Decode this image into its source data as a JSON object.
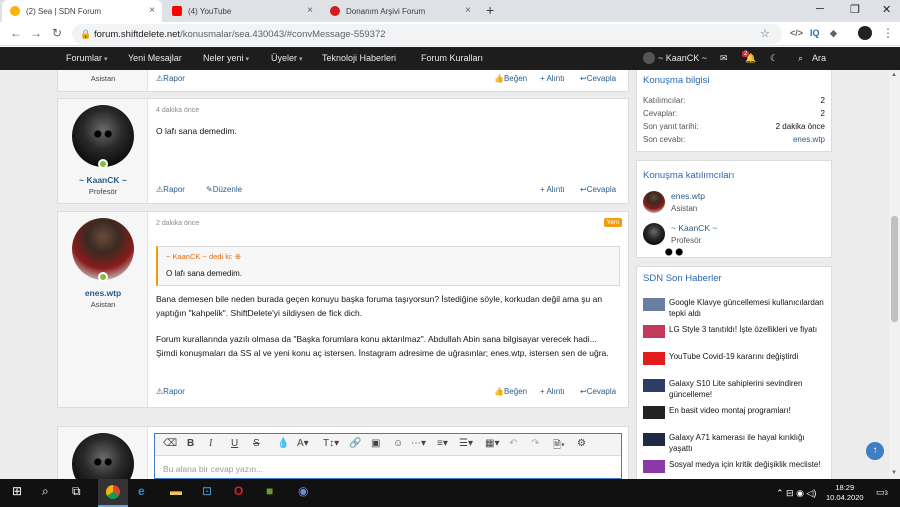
{
  "browser": {
    "tabs": [
      {
        "title": "(2) Sea | SDN Forum",
        "fav_color": "#f7b500",
        "active": true
      },
      {
        "title": "(4) YouTube",
        "fav_color": "#ff0000",
        "active": false
      },
      {
        "title": "Donanım Arşivi Forum",
        "fav_color": "#d71920",
        "active": false
      }
    ],
    "url_host": "forum.shiftdelete.net",
    "url_path": "/konusmalar/sea.430043/#convMessage-559372",
    "extensions": [
      "IQ"
    ]
  },
  "site_nav": {
    "items": [
      {
        "label": "Forumlar",
        "dropdown": true
      },
      {
        "label": "Yeni Mesajlar",
        "dropdown": false
      },
      {
        "label": "Neler yeni",
        "dropdown": true
      },
      {
        "label": "Üyeler",
        "dropdown": true
      },
      {
        "label": "Teknoloji Haberleri",
        "dropdown": false
      },
      {
        "label": "Forum Kuralları",
        "dropdown": false
      }
    ],
    "user": "~ KaanCK ~",
    "alerts_badge": "2",
    "search_label": "Ara"
  },
  "posts": [
    {
      "partial": true,
      "user_title": "Asistan",
      "actions": {
        "report": "Rapor",
        "like": "Beğen",
        "quote": "+ Alıntı",
        "reply": "Cevapla"
      }
    },
    {
      "time": "4 dakika önce",
      "username": "~ KaanCK ~",
      "user_title": "Profesör",
      "message": "O lafı sana demedim.",
      "actions": {
        "report": "Rapor",
        "edit": "Düzenle",
        "quote": "+ Alıntı",
        "reply": "Cevapla"
      }
    },
    {
      "time": "2 dakika önce",
      "new_tag": "Yeni",
      "username": "enes.wtp",
      "user_title": "Asistan",
      "quote": {
        "header": "~ KaanCK ~ dedi ki:",
        "text": "O lafı sana demedim."
      },
      "paragraphs": [
        "Bana demesen bile neden burada geçen konuyu başka foruma taşıyorsun? İstediğine söyle, korkudan değil ama şu an yaptığın \"kahpelik\". ShiftDelete'yi sildiysen de fick dich.",
        "Forum kurallarında yazılı olmasa da \"Başka forumlara konu aktarılmaz\". Abdullah Abin sana bilgisayar verecek hadi... Şimdi konuşmaları da SS al ve yeni konu aç istersen. İnstagram adresime de uğrasınlar; enes.wtp, istersen sen de uğra."
      ],
      "actions": {
        "report": "Rapor",
        "like": "Beğen",
        "quote": "+ Alıntı",
        "reply": "Cevapla"
      }
    }
  ],
  "editor": {
    "placeholder": "Bu alana bir cevap yazın..."
  },
  "sidebar": {
    "info": {
      "title": "Konuşma bilgisi",
      "rows": [
        {
          "label": "Katılımcılar:",
          "value": "2"
        },
        {
          "label": "Cevaplar:",
          "value": "2"
        },
        {
          "label": "Son yanıt tarihi:",
          "value": "2 dakika önce"
        },
        {
          "label": "Son cevabı:",
          "value": "enes.wtp"
        }
      ]
    },
    "participants": {
      "title": "Konuşma katılımcıları",
      "items": [
        {
          "name": "enes.wtp",
          "title": "Asistan"
        },
        {
          "name": "~ KaanCK ~",
          "title": "Profesör"
        }
      ]
    },
    "news": {
      "title": "SDN Son Haberler",
      "items": [
        "Google Klavye güncellemesi kullanıcılardan tepki aldı",
        "LG Style 3 tanıtıldı! İşte özellikleri ve fiyatı",
        "YouTube Covid-19 kararını değiştirdi",
        "Galaxy S10 Lite sahiplerini sevindiren güncelleme!",
        "En basit video montaj programları!",
        "Galaxy A71 kamerası ile hayal kırıklığı yaşattı",
        "Sosyal medya için kritik değişiklik mecliste!"
      ]
    }
  },
  "taskbar": {
    "time": "18:29",
    "date": "10.04.2020",
    "notif_count": "3"
  }
}
